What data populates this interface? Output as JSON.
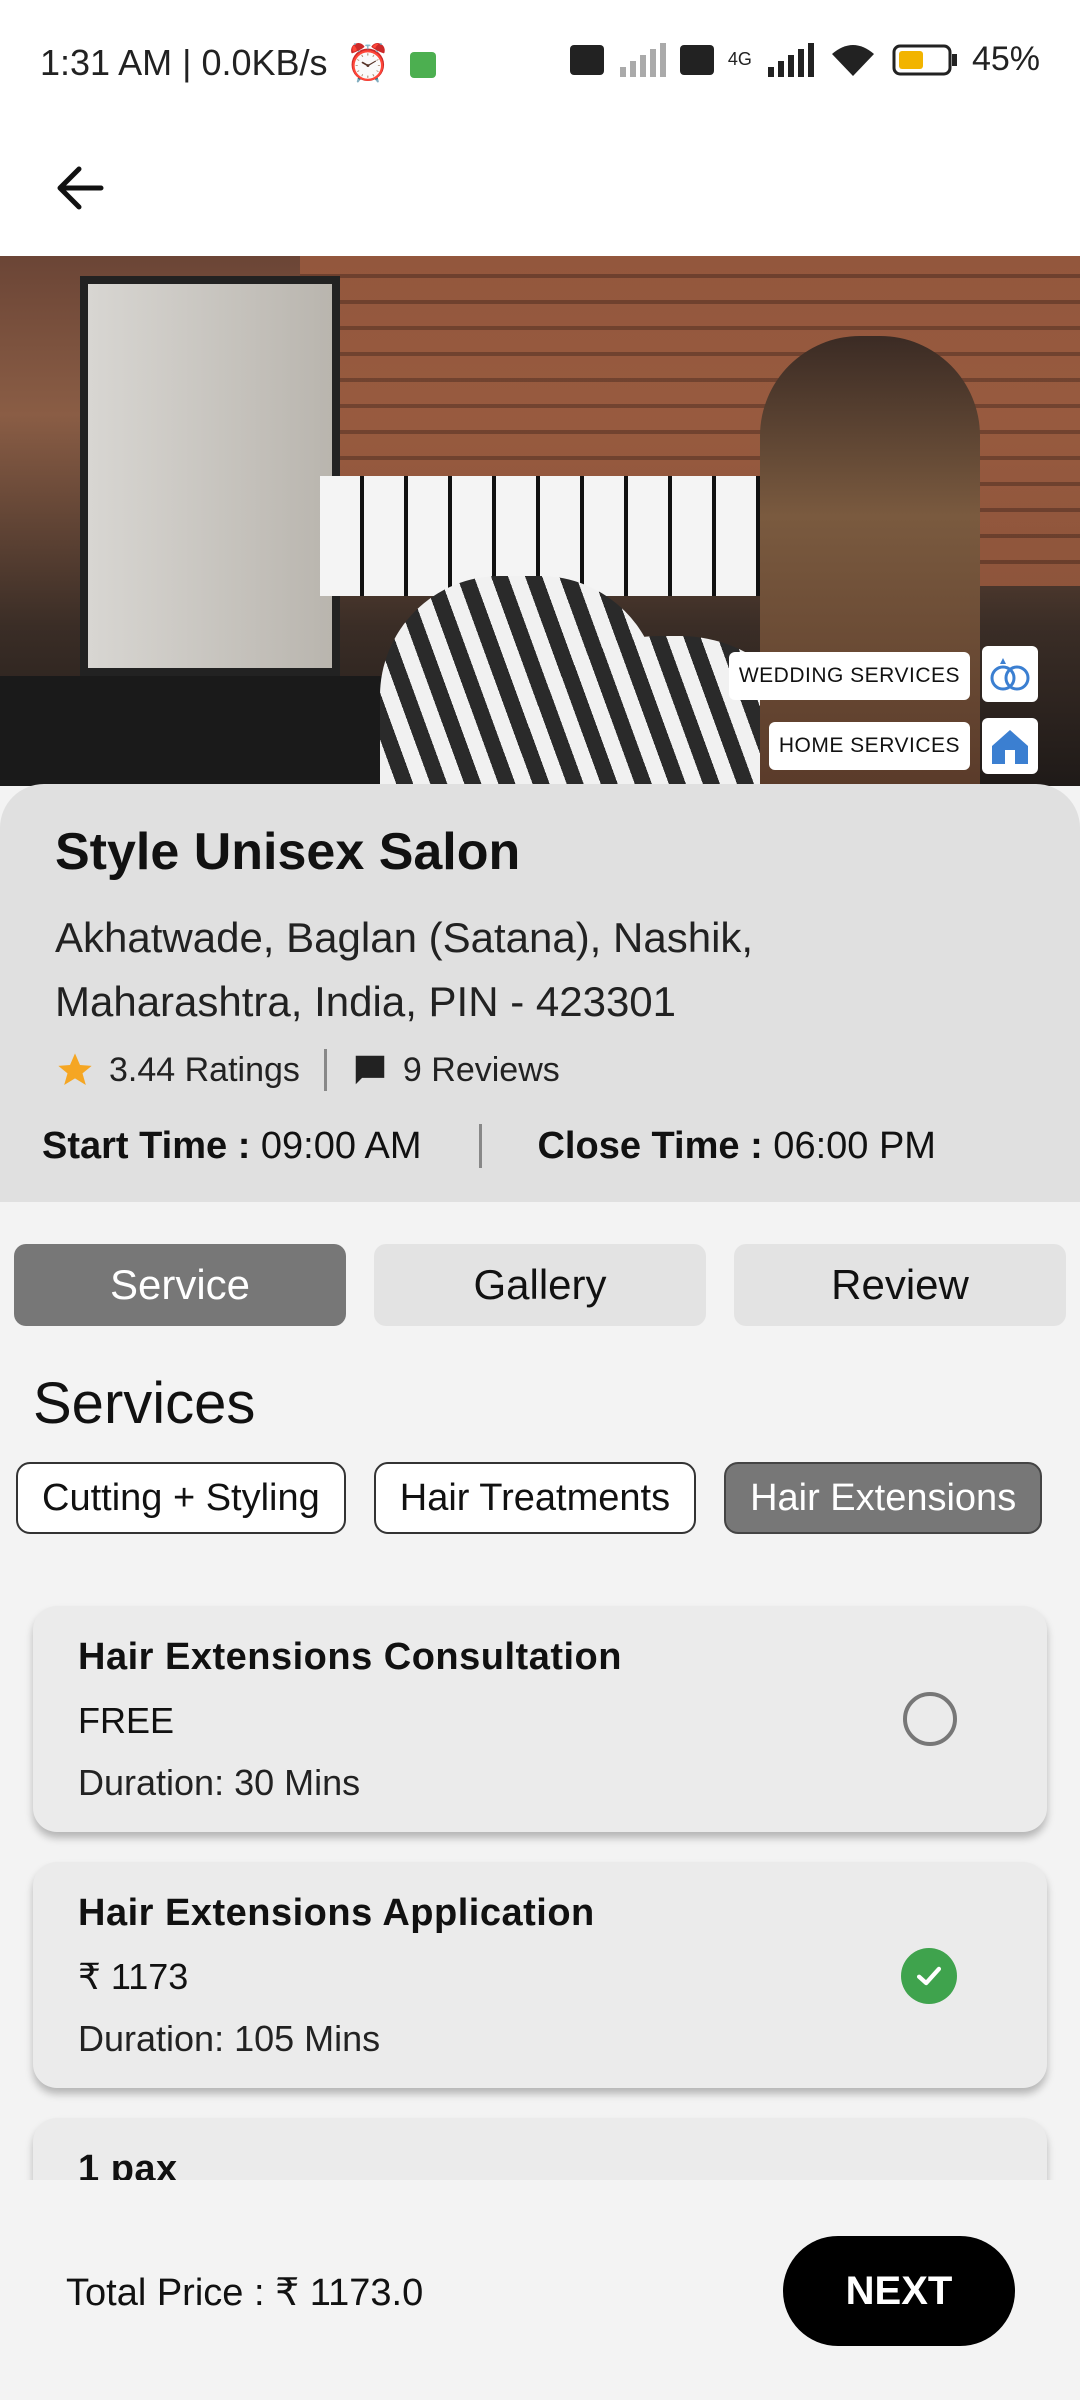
{
  "status_bar": {
    "time": "1:31 AM | 0.0KB/s",
    "network": "4G",
    "battery": "45%"
  },
  "hero": {
    "tags": [
      {
        "label": "WEDDING SERVICES",
        "icon": "rings-icon"
      },
      {
        "label": "HOME SERVICES",
        "icon": "home-icon"
      }
    ]
  },
  "salon": {
    "name": "Style Unisex Salon",
    "address": "Akhatwade, Baglan (Satana), Nashik, Maharashtra, India, PIN - 423301",
    "ratings": "3.44 Ratings",
    "reviews": "9 Reviews",
    "start_label": "Start Time :",
    "start_time": " 09:00 AM",
    "close_label": "Close Time :",
    "close_time": " 06:00 PM"
  },
  "tabs": [
    {
      "label": "Service",
      "active": true
    },
    {
      "label": "Gallery",
      "active": false
    },
    {
      "label": "Review",
      "active": false
    }
  ],
  "services_title": "Services",
  "chips": [
    {
      "label": "Cutting + Styling",
      "active": false
    },
    {
      "label": "Hair Treatments",
      "active": false
    },
    {
      "label": "Hair Extensions",
      "active": true
    }
  ],
  "services": [
    {
      "title": "Hair Extensions Consultation",
      "price": "FREE",
      "duration": "Duration: 30 Mins",
      "selected": false
    },
    {
      "title": "Hair Extensions Application",
      "price": "₹ 1173",
      "duration": "Duration: 105 Mins",
      "selected": true
    },
    {
      "title": "1 pax",
      "price": "",
      "duration": "",
      "selected": false
    }
  ],
  "bottom": {
    "total": "Total Price : ₹ 1173.0",
    "next": "NEXT"
  },
  "colors": {
    "accent_active": "#777777",
    "check_green": "#3fa34d",
    "star": "#f5a623"
  }
}
